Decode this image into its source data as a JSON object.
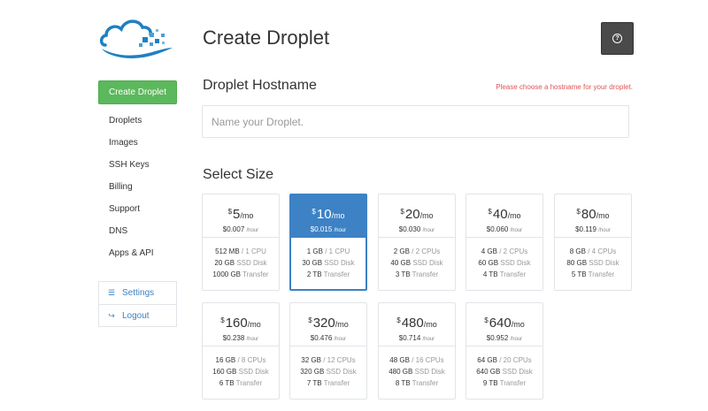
{
  "page": {
    "title": "Create Droplet",
    "help_glyph": "?"
  },
  "sidebar": {
    "create_label": "Create Droplet",
    "nav": [
      "Droplets",
      "Images",
      "SSH Keys",
      "Billing",
      "Support",
      "DNS",
      "Apps & API"
    ],
    "account": [
      {
        "label": "Settings",
        "icon": "settings-icon",
        "glyph": "☰"
      },
      {
        "label": "Logout",
        "icon": "logout-icon",
        "glyph": "↪"
      }
    ]
  },
  "hostname": {
    "heading": "Droplet Hostname",
    "error": "Please choose a hostname for your droplet.",
    "placeholder": "Name your Droplet."
  },
  "size": {
    "heading": "Select Size",
    "plans": [
      {
        "price": "5",
        "hourly": "$0.007",
        "ram": "512 MB",
        "cpu": "1 CPU",
        "disk": "20 GB",
        "transfer": "1000 GB",
        "selected": false
      },
      {
        "price": "10",
        "hourly": "$0.015",
        "ram": "1 GB",
        "cpu": "1 CPU",
        "disk": "30 GB",
        "transfer": "2 TB",
        "selected": true
      },
      {
        "price": "20",
        "hourly": "$0.030",
        "ram": "2 GB",
        "cpu": "2 CPUs",
        "disk": "40 GB",
        "transfer": "3 TB",
        "selected": false
      },
      {
        "price": "40",
        "hourly": "$0.060",
        "ram": "4 GB",
        "cpu": "2 CPUs",
        "disk": "60 GB",
        "transfer": "4 TB",
        "selected": false
      },
      {
        "price": "80",
        "hourly": "$0.119",
        "ram": "8 GB",
        "cpu": "4 CPUs",
        "disk": "80 GB",
        "transfer": "5 TB",
        "selected": false
      },
      {
        "price": "160",
        "hourly": "$0.238",
        "ram": "16 GB",
        "cpu": "8 CPUs",
        "disk": "160 GB",
        "transfer": "6 TB",
        "selected": false
      },
      {
        "price": "320",
        "hourly": "$0.476",
        "ram": "32 GB",
        "cpu": "12 CPUs",
        "disk": "320 GB",
        "transfer": "7 TB",
        "selected": false
      },
      {
        "price": "480",
        "hourly": "$0.714",
        "ram": "48 GB",
        "cpu": "16 CPUs",
        "disk": "480 GB",
        "transfer": "8 TB",
        "selected": false
      },
      {
        "price": "640",
        "hourly": "$0.952",
        "ram": "64 GB",
        "cpu": "20 CPUs",
        "disk": "640 GB",
        "transfer": "9 TB",
        "selected": false
      }
    ],
    "units": {
      "currency": "$",
      "per_month": "/mo",
      "per_hour": "/hour",
      "ssd": "SSD Disk",
      "transfer": "Transfer"
    }
  },
  "colors": {
    "brand_green": "#5cb85c",
    "link_blue": "#3d82c4",
    "selected_blue": "#3d82c4",
    "error_red": "#e05454"
  }
}
